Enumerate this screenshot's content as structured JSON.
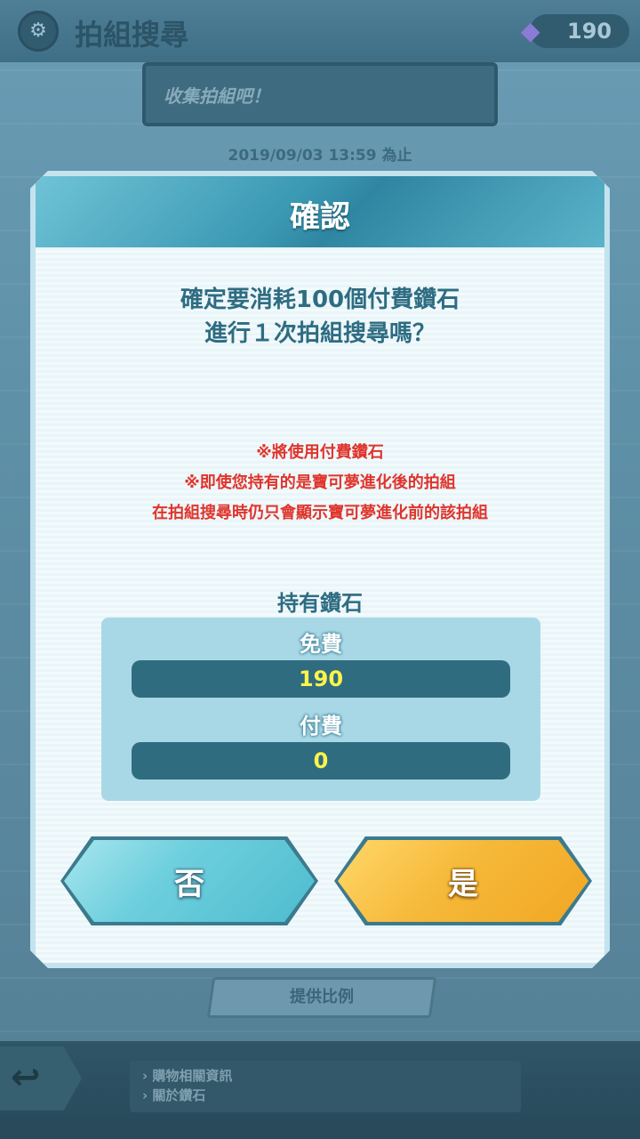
{
  "header": {
    "title": "拍組搜尋",
    "gem_count": "190"
  },
  "banner": {
    "text": "收集拍組吧！"
  },
  "deadline": "2019/09/03 13:59 為止",
  "dialog": {
    "title": "確認",
    "question_line1": "確定要消耗100個付費鑽石",
    "question_line2": "進行１次拍組搜尋嗎？",
    "warning_1": "※將使用付費鑽石",
    "warning_2": "※即使您持有的是寶可夢進化後的拍組",
    "warning_3": "在拍組搜尋時仍只會顯示寶可夢進化前的該拍組",
    "held_label": "持有鑽石",
    "free_label": "免費",
    "free_value": "190",
    "paid_label": "付費",
    "paid_value": "0",
    "no_label": "否",
    "yes_label": "是"
  },
  "footer": {
    "rate_button": "提供比例",
    "link_1": "› 購物相關資訊",
    "link_2": "› 關於鑽石"
  },
  "colors": {
    "accent": "#2f6c7f",
    "warning": "#e0342c",
    "yes_button": "#f6b93a",
    "no_button": "#6ecfdd"
  }
}
